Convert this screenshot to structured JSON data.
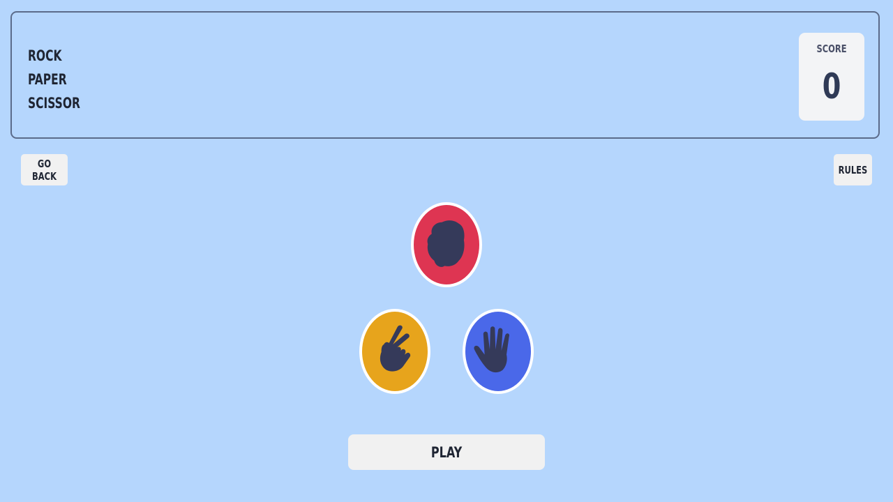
{
  "header": {
    "titles": [
      "ROCK",
      "PAPER",
      "SCISSOR"
    ]
  },
  "score": {
    "label": "SCORE",
    "value": "0"
  },
  "nav": {
    "back_label": "GO BACK",
    "rules_label": "RULES"
  },
  "choices": [
    {
      "name": "rock",
      "icon": "rock-fist-icon",
      "color": "#de3552"
    },
    {
      "name": "scissor",
      "icon": "scissor-hand-icon",
      "color": "#e7a41c"
    },
    {
      "name": "paper",
      "icon": "paper-hand-icon",
      "color": "#4a68e9"
    }
  ],
  "play": {
    "label": "PLAY"
  },
  "colors": {
    "background": "#b5d6fd",
    "icon_fill": "#353a5a"
  }
}
